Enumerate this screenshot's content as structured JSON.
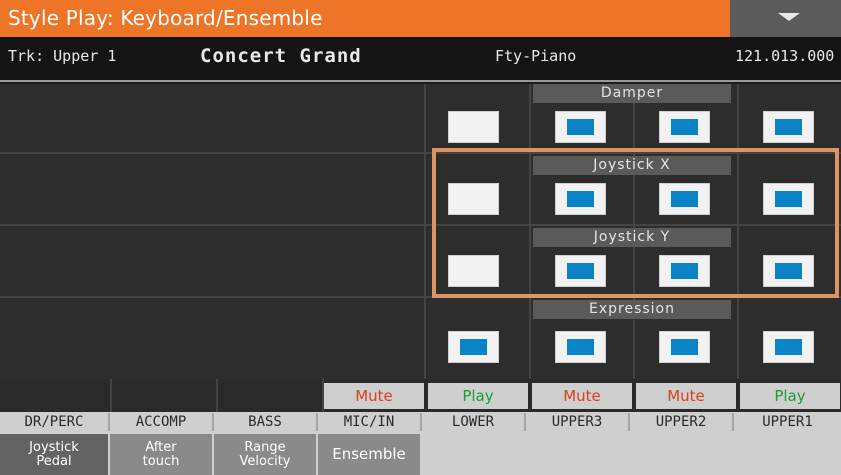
{
  "header": {
    "title": "Style Play: Keyboard/Ensemble",
    "menu_icon": "chevron-down-icon"
  },
  "track": {
    "label": "Trk: Upper 1",
    "sound": "Concert Grand",
    "category": "Fty-Piano",
    "number": "121.013.000"
  },
  "sections": {
    "damper": "Damper",
    "joystick_x": "Joystick X",
    "joystick_y": "Joystick Y",
    "expression": "Expression"
  },
  "checkboxes": {
    "damper": {
      "lower": false,
      "upper3": true,
      "upper2": true,
      "upper1": true
    },
    "joystick_x": {
      "lower": false,
      "upper3": true,
      "upper2": true,
      "upper1": true
    },
    "joystick_y": {
      "lower": false,
      "upper3": true,
      "upper2": true,
      "upper1": true
    },
    "expression": {
      "lower": true,
      "upper3": true,
      "upper2": true,
      "upper1": true
    }
  },
  "status": {
    "mic_in": "Mute",
    "lower": "Play",
    "upper3": "Mute",
    "upper2": "Mute",
    "upper1": "Play"
  },
  "channels": [
    "DR/PERC",
    "ACCOMP",
    "BASS",
    "MIC/IN",
    "LOWER",
    "UPPER3",
    "UPPER2",
    "UPPER1"
  ],
  "tabs": {
    "joystick_line1": "Joystick",
    "joystick_line2": "Pedal",
    "after_line1": "After",
    "after_line2": "touch",
    "range_line1": "Range",
    "range_line2": "Velocity",
    "ensemble": "Ensemble"
  },
  "colors": {
    "title_bar": "#ee7427",
    "checkbox_on": "#0a84c6",
    "highlight": "#dd9663",
    "mute_text": "#d9421f",
    "play_text": "#1c9c36"
  }
}
